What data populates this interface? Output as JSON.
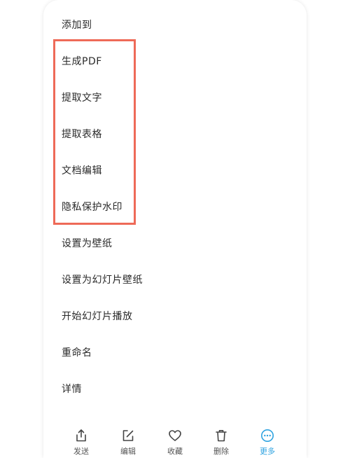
{
  "menu": {
    "items": [
      {
        "label": "添加到"
      },
      {
        "label": "生成PDF"
      },
      {
        "label": "提取文字"
      },
      {
        "label": "提取表格"
      },
      {
        "label": "文档编辑"
      },
      {
        "label": "隐私保护水印"
      },
      {
        "label": "设置为壁纸"
      },
      {
        "label": "设置为幻灯片壁纸"
      },
      {
        "label": "开始幻灯片播放"
      },
      {
        "label": "重命名"
      },
      {
        "label": "详情"
      }
    ]
  },
  "toolbar": {
    "send_label": "发送",
    "edit_label": "编辑",
    "favorite_label": "收藏",
    "delete_label": "删除",
    "more_label": "更多"
  },
  "colors": {
    "text": "#2a2a2a",
    "highlight_border": "#ee6a58",
    "accent": "#2fa3e0",
    "toolbar_text": "#555555"
  },
  "icons": [
    "share-icon",
    "edit-icon",
    "heart-icon",
    "trash-icon",
    "more-dots-icon"
  ]
}
